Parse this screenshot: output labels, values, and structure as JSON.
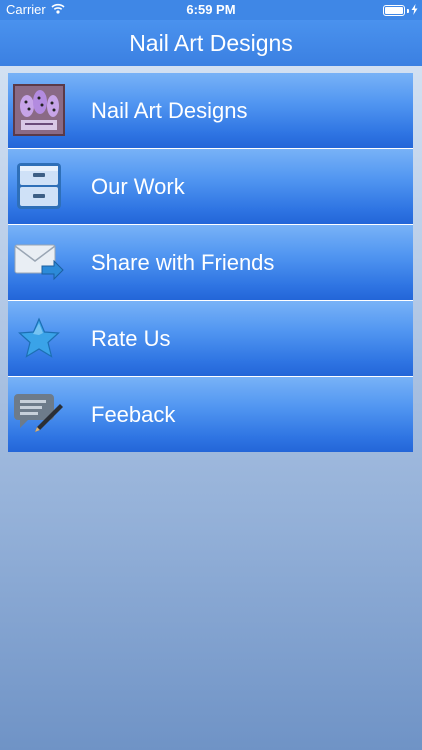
{
  "status_bar": {
    "carrier": "Carrier",
    "time": "6:59 PM",
    "battery_level": 1.0
  },
  "nav": {
    "title": "Nail Art Designs"
  },
  "menu": {
    "items": [
      {
        "label": "Nail Art Designs",
        "icon": "nail-art-thumbnail-icon"
      },
      {
        "label": "Our Work",
        "icon": "drawer-cabinet-icon"
      },
      {
        "label": "Share with Friends",
        "icon": "envelope-share-icon"
      },
      {
        "label": "Rate Us",
        "icon": "star-icon"
      },
      {
        "label": "Feeback",
        "icon": "chat-pencil-icon"
      }
    ]
  },
  "colors": {
    "nav_bar": "#3b80e2",
    "menu_item_top": "#78b2f7",
    "menu_item_bottom": "#2366d8"
  }
}
